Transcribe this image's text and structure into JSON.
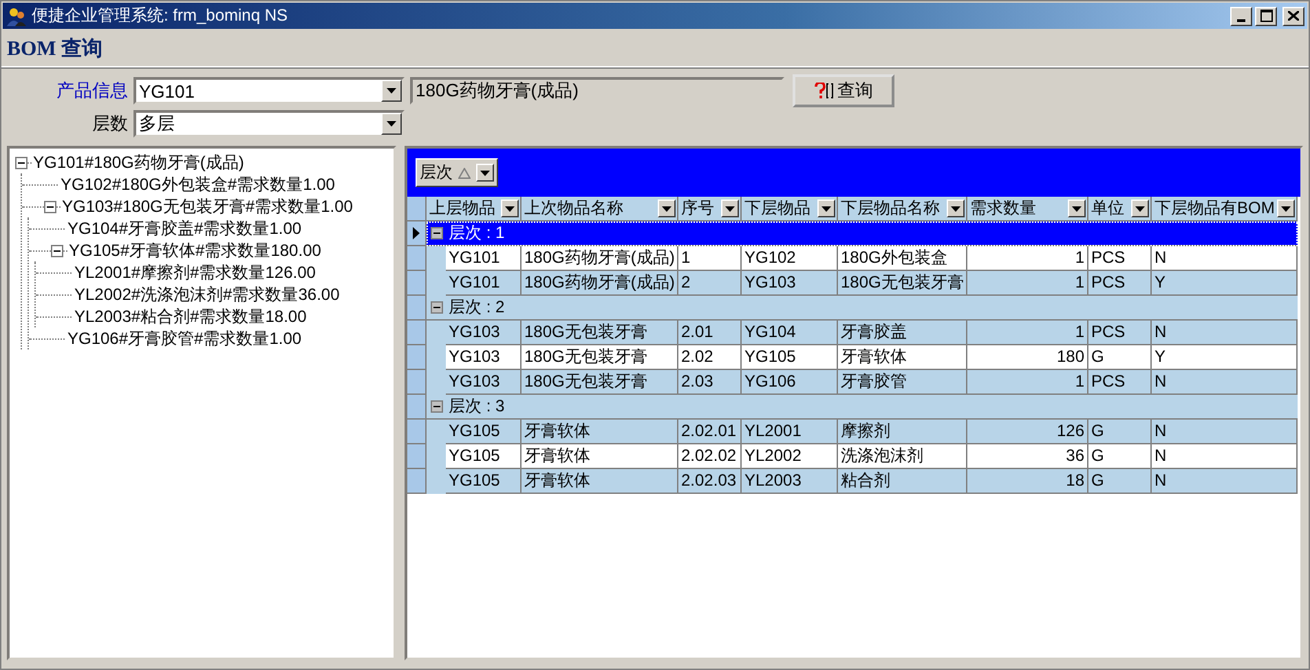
{
  "window": {
    "title": "便捷企业管理系统: frm_bominq NS"
  },
  "header": {
    "title": "BOM 查询"
  },
  "form": {
    "product_label": "产品信息",
    "product_value": "YG101",
    "product_name": "180G药物牙膏(成品)",
    "levels_label": "层数",
    "levels_value": "多层",
    "query_button": "查询"
  },
  "tree": [
    {
      "label": "YG101#180G药物牙膏(成品)",
      "expanded": true,
      "children": [
        {
          "label": "YG102#180G外包装盒#需求数量1.00"
        },
        {
          "label": "YG103#180G无包装牙膏#需求数量1.00",
          "expanded": true,
          "children": [
            {
              "label": "YG104#牙膏胶盖#需求数量1.00"
            },
            {
              "label": "YG105#牙膏软体#需求数量180.00",
              "expanded": true,
              "children": [
                {
                  "label": "YL2001#摩擦剂#需求数量126.00"
                },
                {
                  "label": "YL2002#洗涤泡沫剂#需求数量36.00"
                },
                {
                  "label": "YL2003#粘合剂#需求数量18.00"
                }
              ]
            },
            {
              "label": "YG106#牙膏胶管#需求数量1.00"
            }
          ]
        }
      ]
    }
  ],
  "grid": {
    "group_by": "层次",
    "columns": [
      "上层物品",
      "上次物品名称",
      "序号",
      "下层物品",
      "下层物品名称",
      "需求数量",
      "单位",
      "下层物品有BOM"
    ],
    "groups": [
      {
        "label": "层次 : 1",
        "expanded": true,
        "selected": true,
        "rows": [
          {
            "shaded": false,
            "cells": [
              "YG101",
              "180G药物牙膏(成品)",
              "1",
              "YG102",
              "180G外包装盒",
              "1",
              "PCS",
              "N"
            ]
          },
          {
            "shaded": true,
            "cells": [
              "YG101",
              "180G药物牙膏(成品)",
              "2",
              "YG103",
              "180G无包装牙膏",
              "1",
              "PCS",
              "Y"
            ]
          }
        ]
      },
      {
        "label": "层次 : 2",
        "expanded": true,
        "selected": false,
        "rows": [
          {
            "shaded": true,
            "cells": [
              "YG103",
              "180G无包装牙膏",
              "2.01",
              "YG104",
              "牙膏胶盖",
              "1",
              "PCS",
              "N"
            ]
          },
          {
            "shaded": false,
            "cells": [
              "YG103",
              "180G无包装牙膏",
              "2.02",
              "YG105",
              "牙膏软体",
              "180",
              "G",
              "Y"
            ]
          },
          {
            "shaded": true,
            "cells": [
              "YG103",
              "180G无包装牙膏",
              "2.03",
              "YG106",
              "牙膏胶管",
              "1",
              "PCS",
              "N"
            ]
          }
        ]
      },
      {
        "label": "层次 : 3",
        "expanded": true,
        "selected": false,
        "rows": [
          {
            "shaded": true,
            "cells": [
              "YG105",
              "牙膏软体",
              "2.02.01",
              "YL2001",
              "摩擦剂",
              "126",
              "G",
              "N"
            ]
          },
          {
            "shaded": false,
            "cells": [
              "YG105",
              "牙膏软体",
              "2.02.02",
              "YL2002",
              "洗涤泡沫剂",
              "36",
              "G",
              "N"
            ]
          },
          {
            "shaded": true,
            "cells": [
              "YG105",
              "牙膏软体",
              "2.02.03",
              "YL2003",
              "粘合剂",
              "18",
              "G",
              "N"
            ]
          }
        ]
      }
    ]
  }
}
